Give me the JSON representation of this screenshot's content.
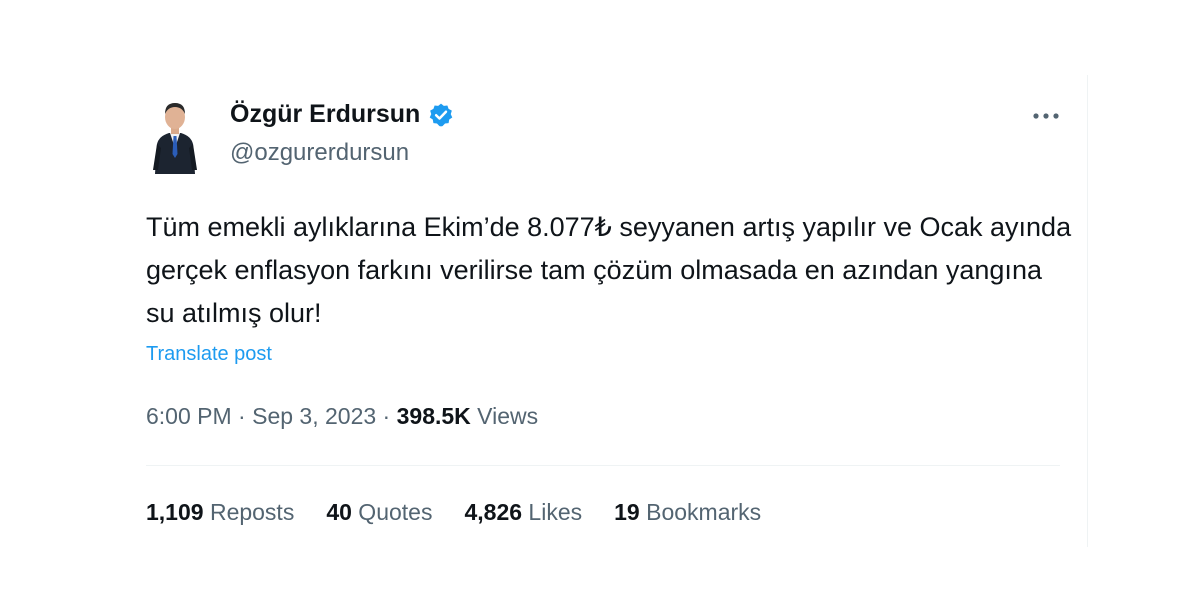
{
  "author": {
    "name": "Özgür Erdursun",
    "handle": "@ozgurerdursun",
    "verified": true
  },
  "tweet": {
    "text": "Tüm emekli aylıklarına Ekim’de 8.077₺ seyyanen artış yapılır ve Ocak ayında gerçek enflasyon farkını verilirse tam çözüm olmasada en azından yangına su atılmış olur!",
    "translate_label": "Translate post",
    "time": "6:00 PM",
    "separator": " · ",
    "date": "Sep 3, 2023",
    "views_count": "398.5K",
    "views_label": " Views"
  },
  "stats": {
    "reposts": {
      "count": "1,109",
      "label": " Reposts"
    },
    "quotes": {
      "count": "40",
      "label": " Quotes"
    },
    "likes": {
      "count": "4,826",
      "label": " Likes"
    },
    "bookmarks": {
      "count": "19",
      "label": " Bookmarks"
    }
  },
  "colors": {
    "text": "#0f1419",
    "secondary": "#536471",
    "link": "#1d9bf0",
    "divider": "#eff3f4"
  },
  "icons": {
    "verified": "verified-badge-icon",
    "more": "more-horizontal-icon"
  }
}
